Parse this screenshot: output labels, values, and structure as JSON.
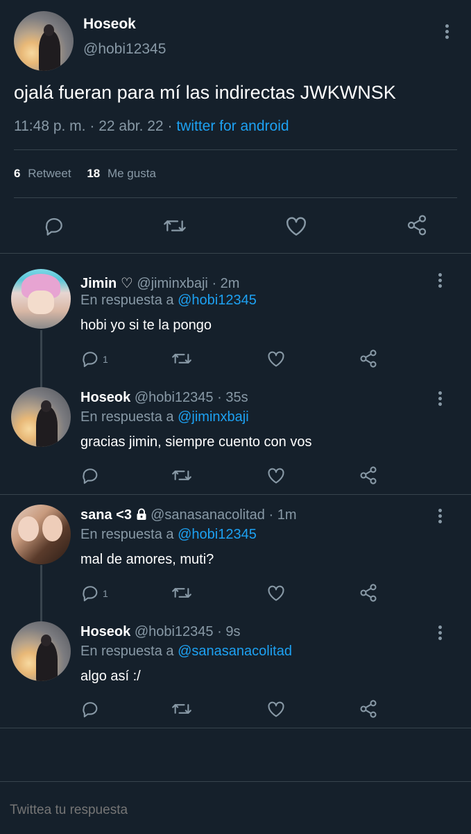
{
  "main_tweet": {
    "display_name": "Hoseok",
    "handle": "@hobi12345",
    "text": "ojalá fueran para mí las indirectas JWKWNSK",
    "time": "11:48 p. m.",
    "dot": "·",
    "date": "22 abr. 22",
    "source": "twitter for android",
    "retweets": "6",
    "retweets_label": "Retweet",
    "likes": "18",
    "likes_label": "Me gusta",
    "avatar_icon": "user-photo-sunset",
    "actions": [
      "reply-icon",
      "retweet-icon",
      "like-icon",
      "share-icon"
    ]
  },
  "replies": [
    {
      "display_name": "Jimin",
      "name_suffix": "♡",
      "handle": "@jiminxbaji",
      "time": "· 2m",
      "in_reply_prefix": "En respuesta a",
      "in_reply_to": "@hobi12345",
      "text": "hobi yo si te la pongo",
      "reply_count": "1"
    },
    {
      "display_name": "Hoseok",
      "name_suffix": "",
      "handle": "@hobi12345",
      "time": "· 35s",
      "in_reply_prefix": "En respuesta a",
      "in_reply_to": "@jiminxbaji",
      "text": "gracias jimin, siempre cuento con vos",
      "reply_count": ""
    },
    {
      "display_name": "sana <3",
      "name_suffix": "",
      "handle": "@sanasanacolitad",
      "time": "· 1m",
      "in_reply_prefix": "En respuesta a",
      "in_reply_to": "@hobi12345",
      "text": "mal de amores, muti?",
      "reply_count": "1",
      "protected": true
    },
    {
      "display_name": "Hoseok",
      "name_suffix": "",
      "handle": "@hobi12345",
      "time": "· 9s",
      "in_reply_prefix": "En respuesta a",
      "in_reply_to": "@sanasanacolitad",
      "text": "algo así :/",
      "reply_count": ""
    }
  ],
  "compose": {
    "placeholder": "Twittea tu respuesta"
  },
  "colors": {
    "background": "#15202b",
    "secondary_text": "#8899a6",
    "link": "#1da1f2",
    "divider": "#38444d"
  }
}
